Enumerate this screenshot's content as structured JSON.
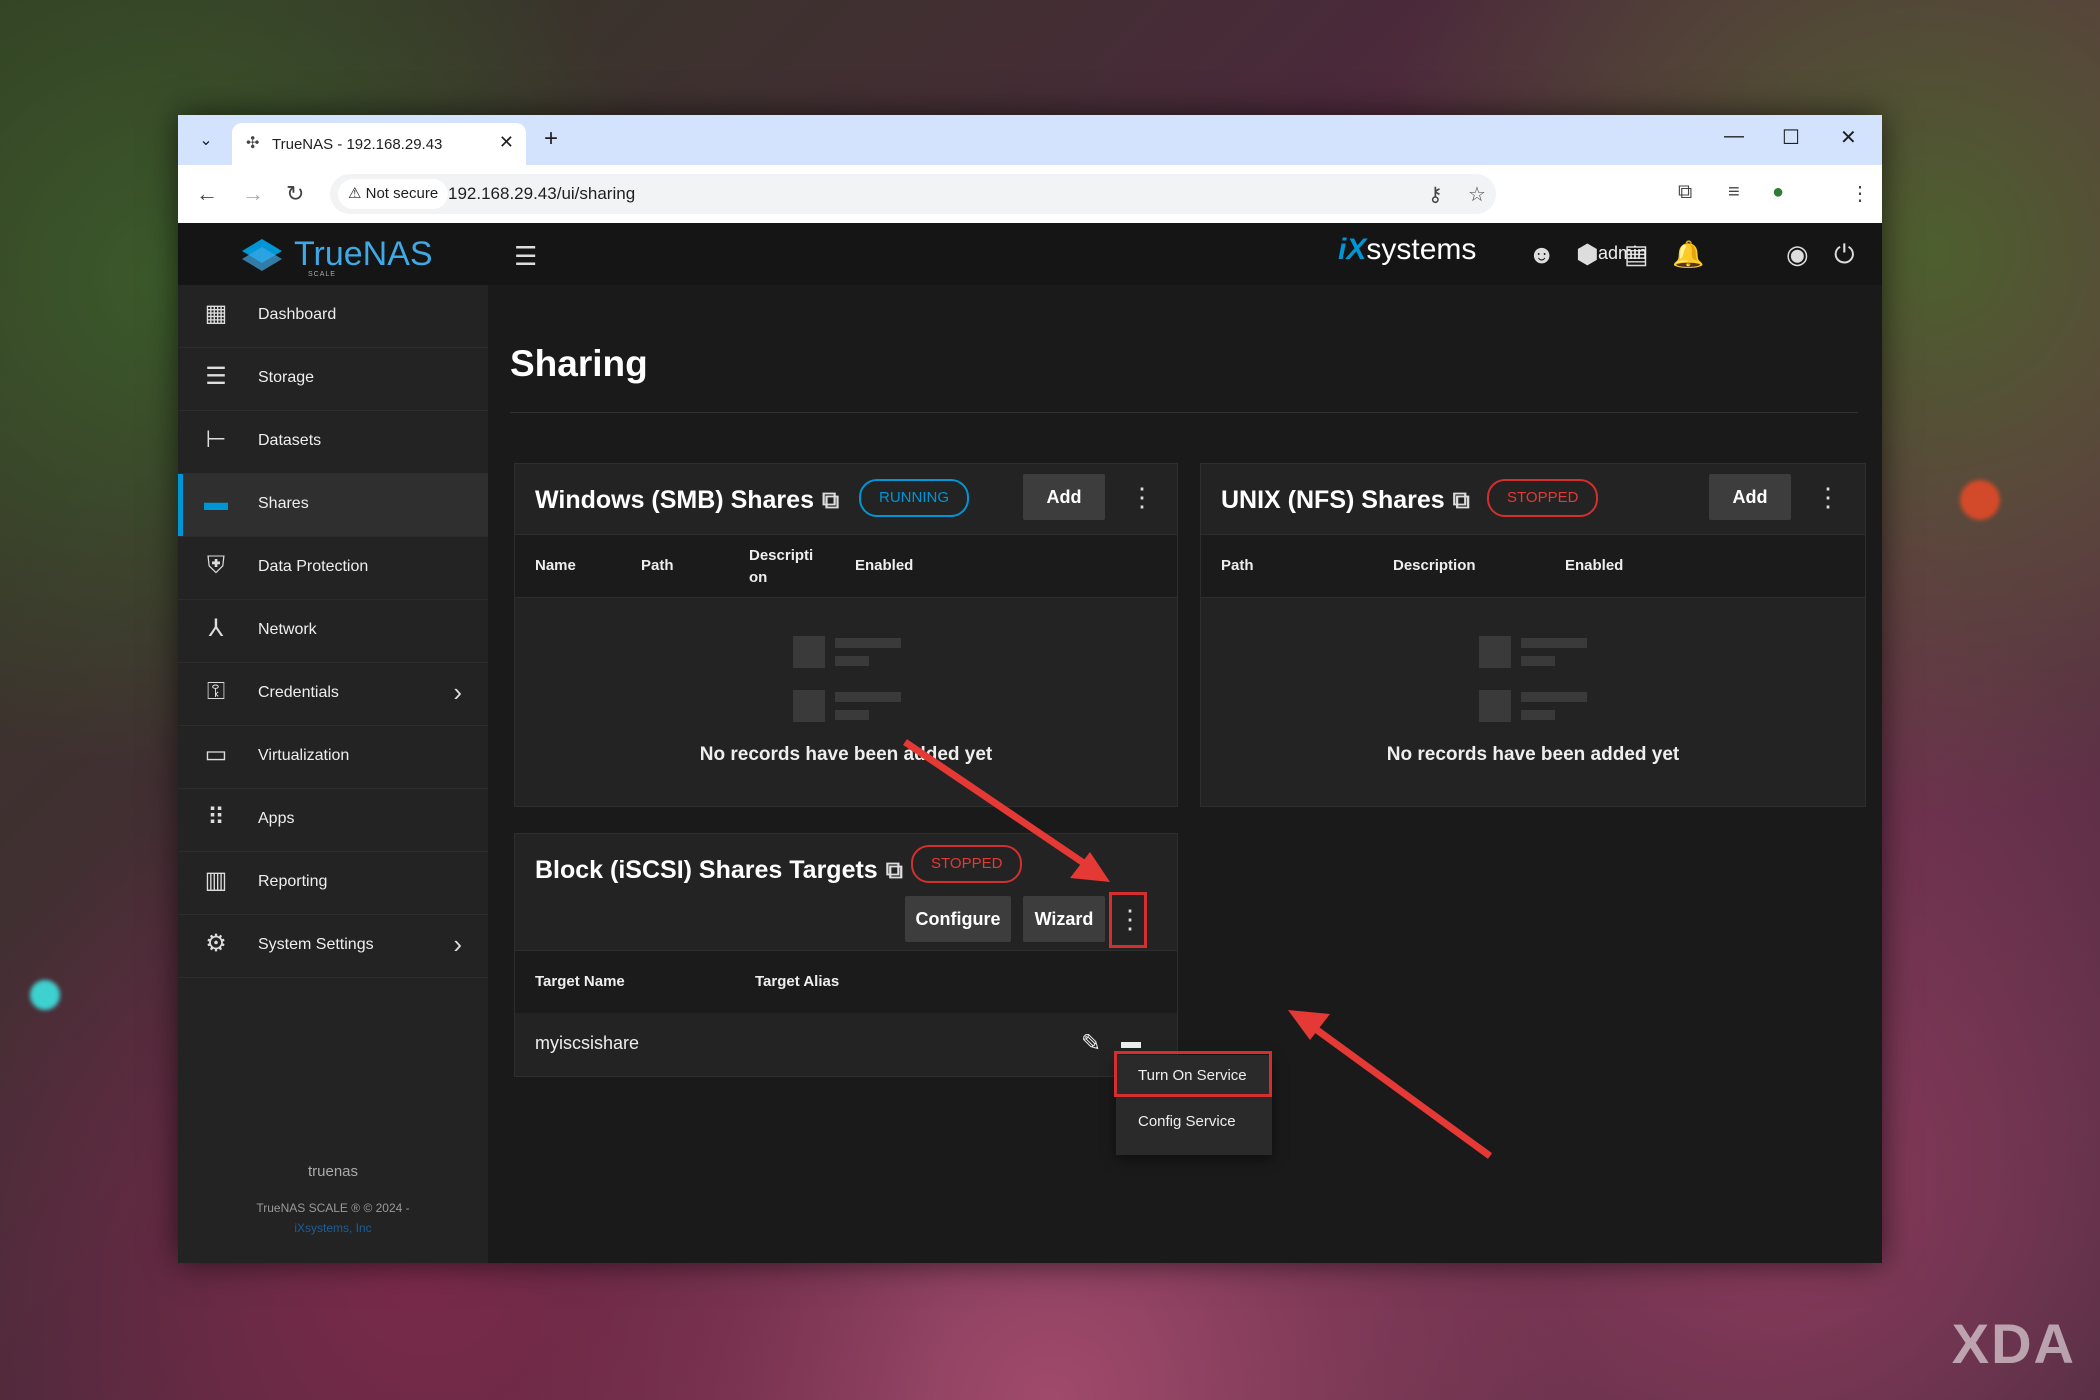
{
  "browser": {
    "tab_title": "TrueNAS - 192.168.29.43",
    "security_label": "Not secure",
    "url": "192.168.29.43/ui/sharing"
  },
  "app": {
    "brand": "TrueNAS",
    "brand_edition": "SCALE",
    "vendor": "systems",
    "vendor_prefix": "iX",
    "username": "admin"
  },
  "sidebar": {
    "items": [
      {
        "label": "Dashboard",
        "icon": "dashboard-icon"
      },
      {
        "label": "Storage",
        "icon": "storage-icon"
      },
      {
        "label": "Datasets",
        "icon": "datasets-icon"
      },
      {
        "label": "Shares",
        "icon": "shares-icon",
        "active": true
      },
      {
        "label": "Data Protection",
        "icon": "shield-icon"
      },
      {
        "label": "Network",
        "icon": "network-icon"
      },
      {
        "label": "Credentials",
        "icon": "key-icon",
        "expandable": true
      },
      {
        "label": "Virtualization",
        "icon": "laptop-icon"
      },
      {
        "label": "Apps",
        "icon": "apps-grid-icon"
      },
      {
        "label": "Reporting",
        "icon": "reporting-icon"
      },
      {
        "label": "System Settings",
        "icon": "gear-icon",
        "expandable": true
      }
    ],
    "hostname": "truenas",
    "copyright": "TrueNAS SCALE ® © 2024 -",
    "company": "iXsystems, Inc"
  },
  "page": {
    "title": "Sharing"
  },
  "smb": {
    "title": "Windows (SMB) Shares",
    "status": "RUNNING",
    "add_label": "Add",
    "columns": [
      "Name",
      "Path",
      "Descripti on",
      "Enabled"
    ],
    "empty_text": "No records have been added yet"
  },
  "nfs": {
    "title": "UNIX (NFS) Shares",
    "status": "STOPPED",
    "add_label": "Add",
    "columns": [
      "Path",
      "Description",
      "Enabled"
    ],
    "empty_text": "No records have been added yet"
  },
  "iscsi": {
    "title": "Block (iSCSI) Shares Targets",
    "status": "STOPPED",
    "configure_label": "Configure",
    "wizard_label": "Wizard",
    "columns": [
      "Target Name",
      "Target Alias"
    ],
    "rows": [
      {
        "target_name": "myiscsishare",
        "target_alias": ""
      }
    ],
    "menu": [
      "Turn On Service",
      "Config Service"
    ]
  },
  "colors": {
    "accent": "#0095d5",
    "running": "#0095d5",
    "stopped": "#e53935",
    "annotation": "#d32f2f"
  },
  "watermark": "XDA"
}
